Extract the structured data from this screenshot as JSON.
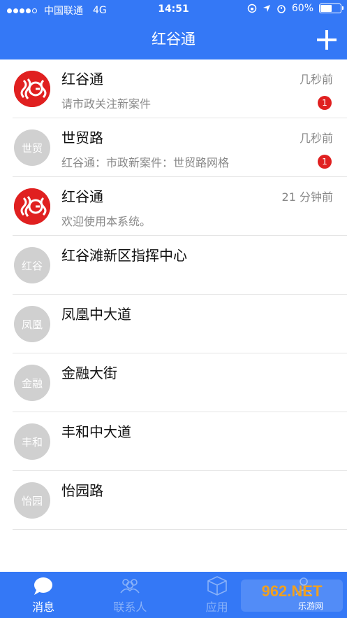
{
  "status_bar": {
    "carrier": "中国联通",
    "network": "4G",
    "time": "14:51",
    "battery": "60%",
    "battery_level": 0.6,
    "signal_bars": 4
  },
  "header": {
    "title": "红谷通",
    "add_icon": "plus-icon"
  },
  "conversations": [
    {
      "avatar": "logo",
      "name": "红谷通",
      "preview": "请市政关注新案件",
      "time": "几秒前",
      "badge": "1"
    },
    {
      "avatar": "世贸",
      "name": "世贸路",
      "preview": "红谷通：市政新案件：世贸路网格",
      "time": "几秒前",
      "badge": "1"
    },
    {
      "avatar": "logo",
      "name": "红谷通",
      "preview": "欢迎使用本系统。",
      "time": "21 分钟前",
      "badge": ""
    },
    {
      "avatar": "红谷",
      "name": "红谷滩新区指挥中心",
      "preview": "",
      "time": "",
      "badge": ""
    },
    {
      "avatar": "凤凰",
      "name": "凤凰中大道",
      "preview": "",
      "time": "",
      "badge": ""
    },
    {
      "avatar": "金融",
      "name": "金融大街",
      "preview": "",
      "time": "",
      "badge": ""
    },
    {
      "avatar": "丰和",
      "name": "丰和中大道",
      "preview": "",
      "time": "",
      "badge": ""
    },
    {
      "avatar": "怡园",
      "name": "怡园路",
      "preview": "",
      "time": "",
      "badge": ""
    }
  ],
  "tabs": [
    {
      "label": "消息",
      "icon": "chat-bubble-icon",
      "active": true
    },
    {
      "label": "联系人",
      "icon": "contacts-icon",
      "active": false
    },
    {
      "label": "应用",
      "icon": "cube-icon",
      "active": false
    },
    {
      "label": "",
      "icon": "user-icon",
      "active": false
    }
  ],
  "watermark": {
    "text": "962.NET",
    "subtext": "乐游网"
  },
  "colors": {
    "primary": "#3478f6",
    "badge": "#e02020",
    "avatar_gray": "#d0d0d0",
    "logo_red": "#e02020"
  }
}
